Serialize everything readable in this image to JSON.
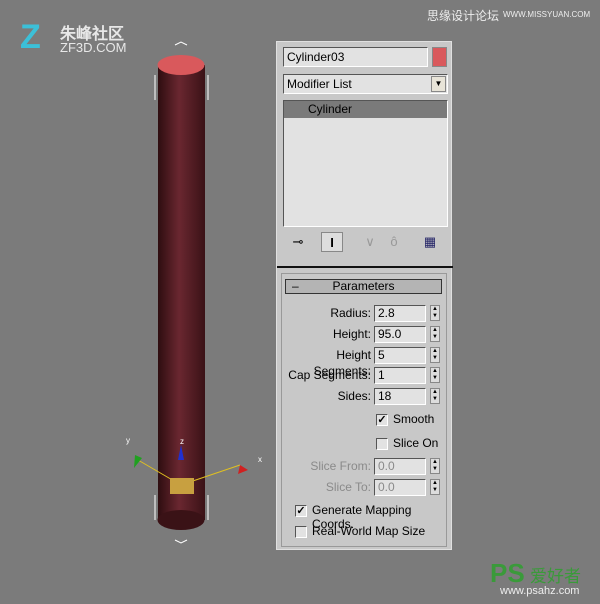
{
  "watermarks": {
    "top_left_cn": "朱峰社区",
    "top_left_en": "ZF3D.COM",
    "top_right_cn": "思缘设计论坛",
    "top_right_en": "WWW.MISSYUAN.COM",
    "bottom_right_cn": "爱好者",
    "bottom_right_logo": "PS",
    "bottom_right_en": "www.psahz.com"
  },
  "object": {
    "name": "Cylinder03",
    "color": "#d9595c"
  },
  "modifier_list": {
    "label": "Modifier List"
  },
  "stack": {
    "items": [
      "Cylinder"
    ]
  },
  "toolbar": {
    "icons": [
      "pin-stack-icon",
      "show-end-result-icon",
      "make-unique-icon",
      "remove-modifier-icon",
      "configure-modifier-sets-icon"
    ]
  },
  "parameters": {
    "title": "Parameters",
    "collapse": "–",
    "radius": {
      "label": "Radius:",
      "value": "2.8"
    },
    "height": {
      "label": "Height:",
      "value": "95.0"
    },
    "height_segments": {
      "label": "Height Segments:",
      "value": "5"
    },
    "cap_segments": {
      "label": "Cap Segments:",
      "value": "1"
    },
    "sides": {
      "label": "Sides:",
      "value": "18"
    },
    "smooth": {
      "label": "Smooth",
      "checked": true
    },
    "slice_on": {
      "label": "Slice On",
      "checked": false
    },
    "slice_from": {
      "label": "Slice From:",
      "value": "0.0"
    },
    "slice_to": {
      "label": "Slice To:",
      "value": "0.0"
    },
    "gen_mapping": {
      "label": "Generate Mapping Coords.",
      "checked": true
    },
    "real_world": {
      "label": "Real-World Map Size",
      "checked": false
    }
  },
  "gizmo": {
    "x": "x",
    "y": "y",
    "z": "z"
  }
}
